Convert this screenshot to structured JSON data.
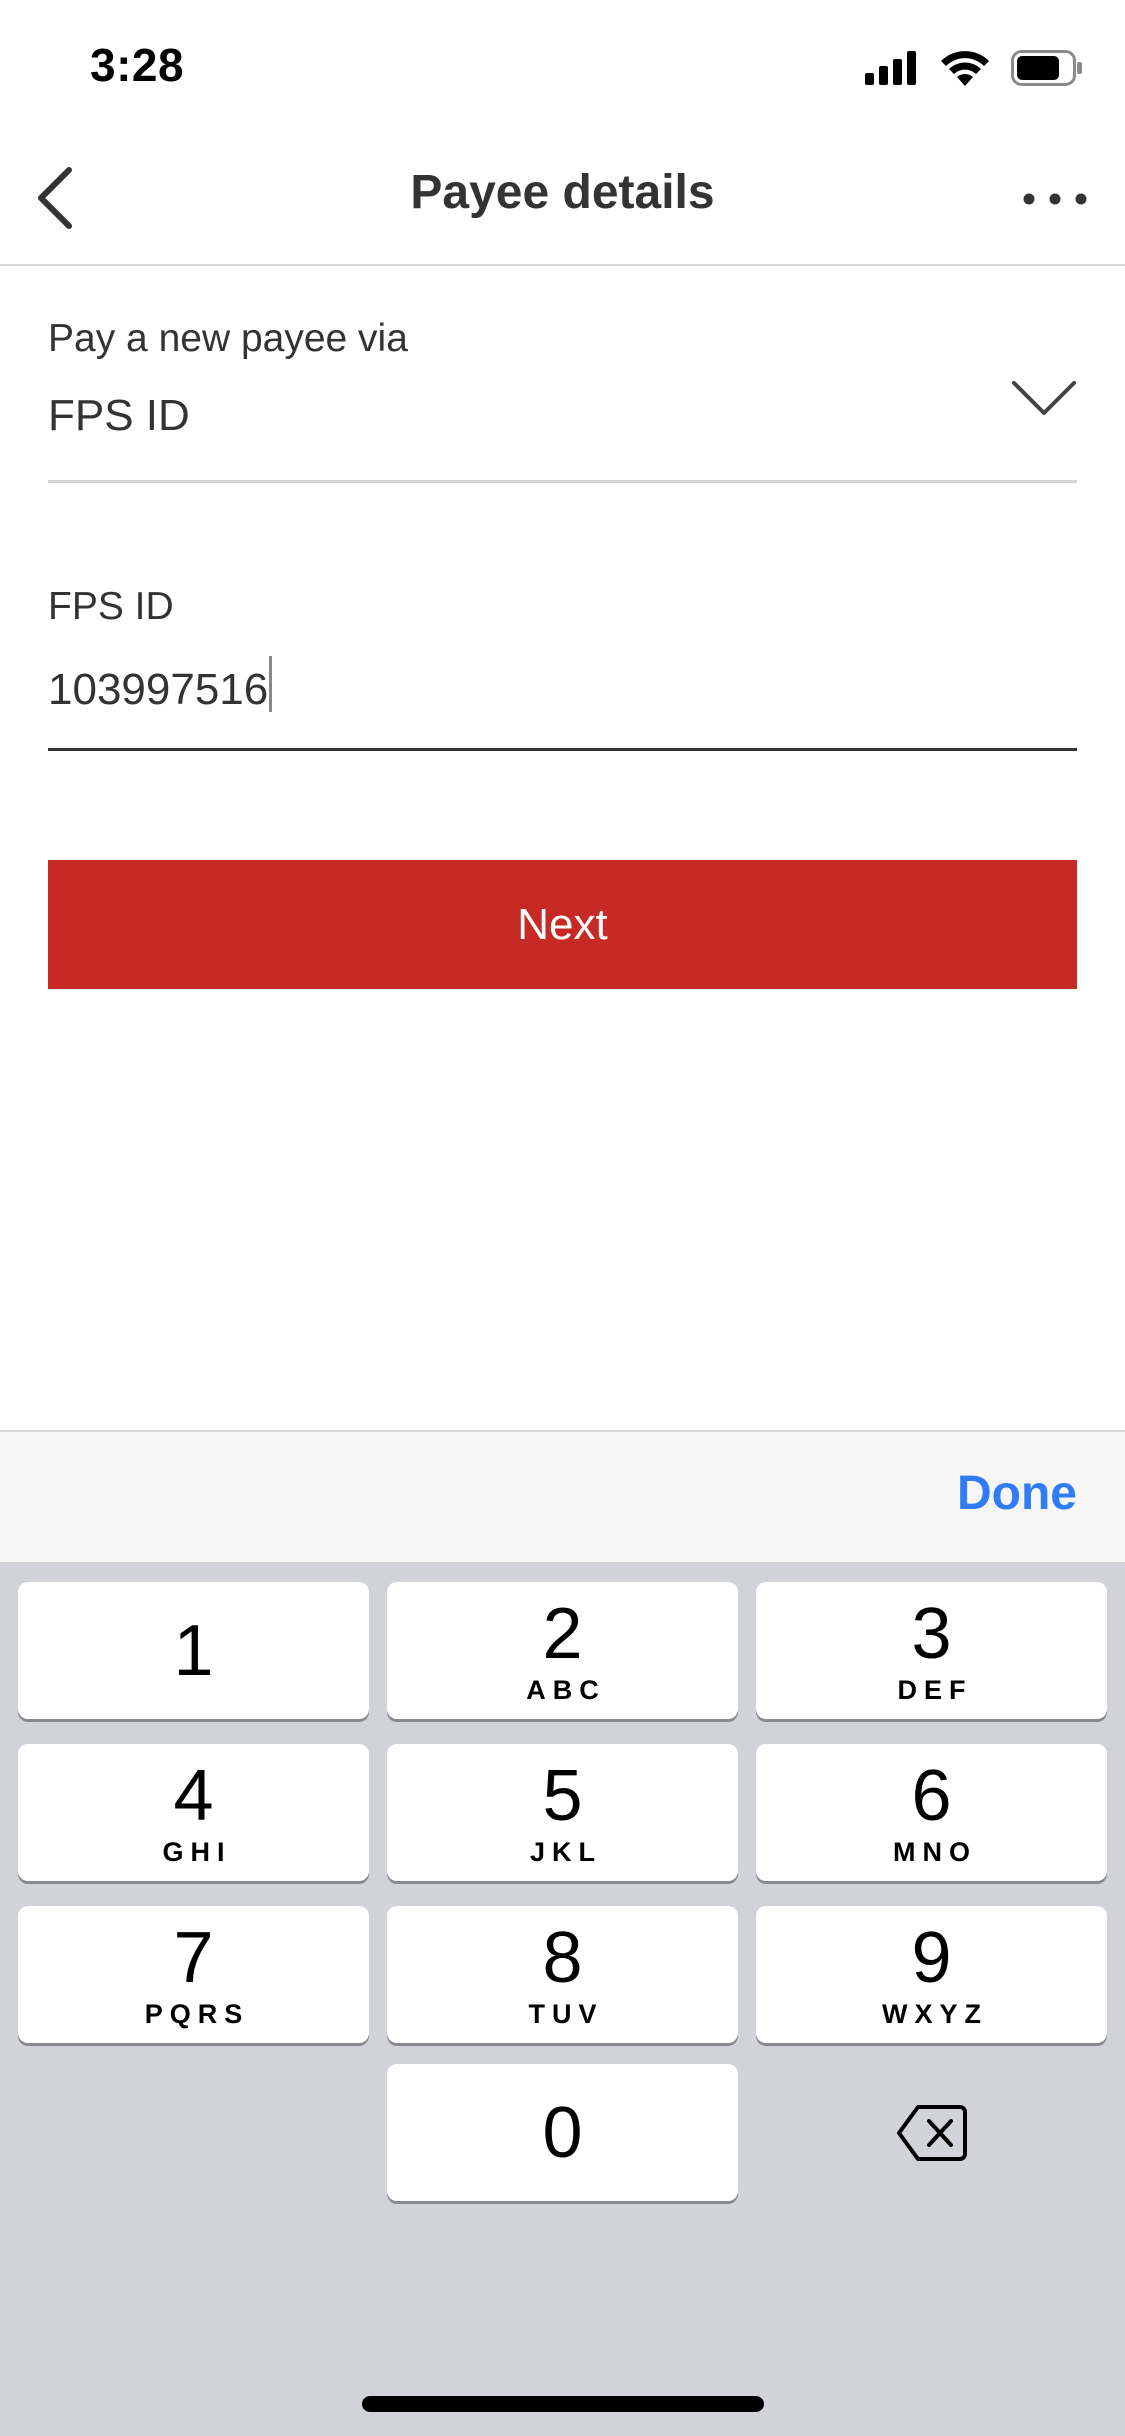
{
  "status_bar": {
    "time": "3:28",
    "icons": [
      "signal-icon",
      "wifi-icon",
      "battery-icon"
    ]
  },
  "header": {
    "title": "Payee details",
    "back_icon": "chevron-left-icon",
    "more_icon": "more-horizontal-icon"
  },
  "form": {
    "pay_via_label": "Pay a new payee via",
    "pay_via_value": "FPS ID",
    "fps_label": "FPS ID",
    "fps_value": "103997516",
    "next_label": "Next"
  },
  "keyboard": {
    "done_label": "Done",
    "keys": [
      {
        "num": "1",
        "letters": ""
      },
      {
        "num": "2",
        "letters": "ABC"
      },
      {
        "num": "3",
        "letters": "DEF"
      },
      {
        "num": "4",
        "letters": "GHI"
      },
      {
        "num": "5",
        "letters": "JKL"
      },
      {
        "num": "6",
        "letters": "MNO"
      },
      {
        "num": "7",
        "letters": "PQRS"
      },
      {
        "num": "8",
        "letters": "TUV"
      },
      {
        "num": "9",
        "letters": "WXYZ"
      },
      {
        "num": "0",
        "letters": ""
      }
    ],
    "backspace_icon": "backspace-icon"
  },
  "colors": {
    "accent_red": "#c72924",
    "done_blue": "#2f7cf6",
    "keyboard_bg": "#d2d3d8"
  }
}
